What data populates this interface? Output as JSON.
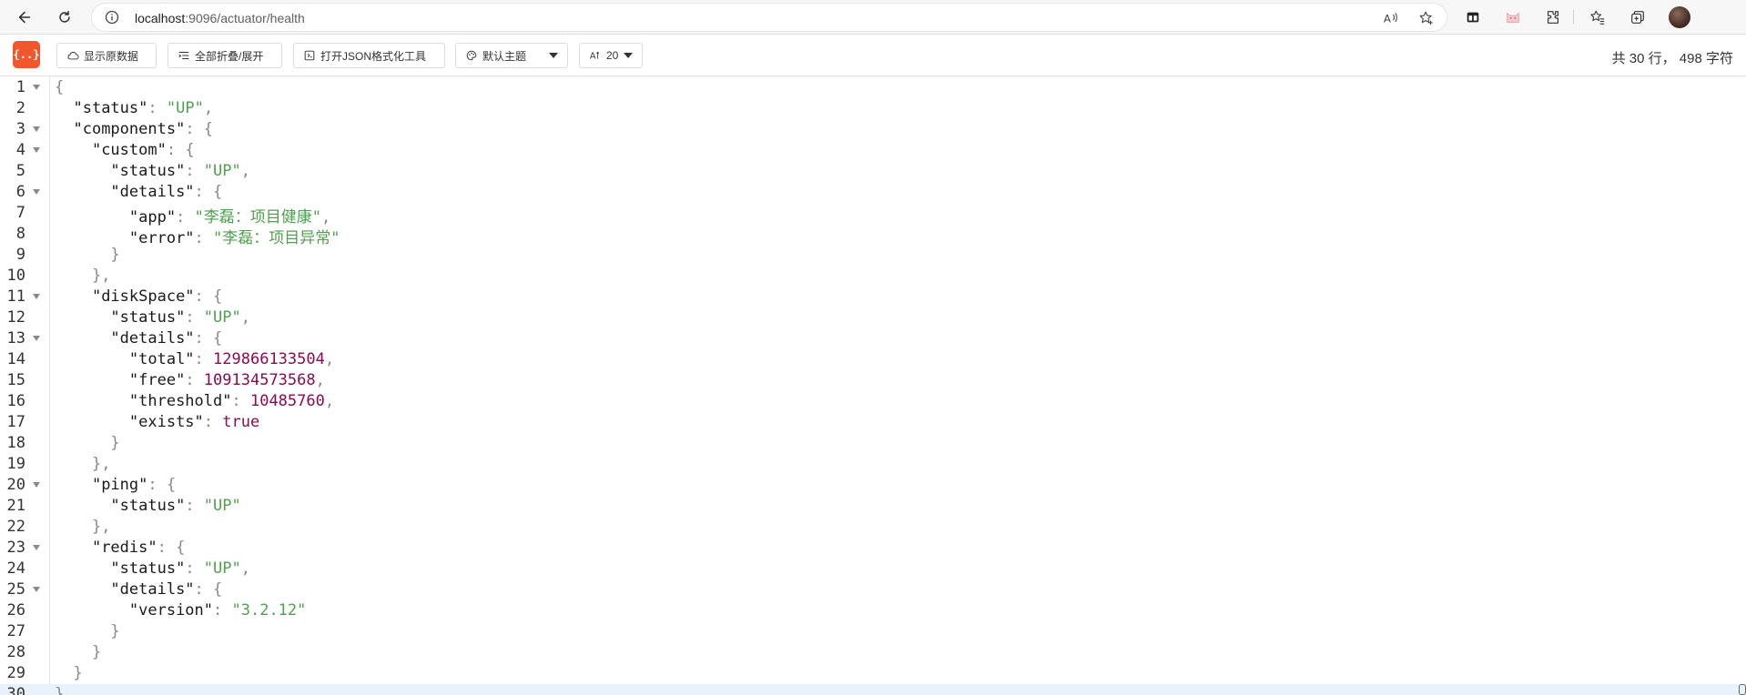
{
  "browser": {
    "url_host": "localhost",
    "url_path": ":9096/actuator/health",
    "icons": [
      "back-arrow-icon",
      "refresh-icon",
      "info-icon",
      "read-aloud-icon",
      "favorite-icon",
      "extension-sidebar-icon",
      "extension-cat-icon",
      "extensions-icon",
      "favorites-icon",
      "collections-icon",
      "profile-avatar"
    ]
  },
  "toolbar": {
    "logo_text": "{..}",
    "show_raw": "显示原数据",
    "fold_all": "全部折叠/展开",
    "open_tool": "打开JSON格式化工具",
    "theme": "默认主题",
    "font_size": "20",
    "stats": "共 30 行， 498 字符"
  },
  "colors": {
    "logo_bg": "#f0572d",
    "key": "#1a1a1a",
    "string": "#50a14f",
    "number": "#8b0a50",
    "punctuation": "#888888",
    "active_line": "#e8f2fc"
  },
  "editor": {
    "lines": [
      {
        "n": "1",
        "fold": true,
        "active": false,
        "tokens": [
          {
            "t": "p",
            "v": "{"
          }
        ]
      },
      {
        "n": "2",
        "fold": false,
        "active": false,
        "tokens": [
          {
            "t": "i",
            "v": "  "
          },
          {
            "t": "k",
            "v": "\"status\""
          },
          {
            "t": "p",
            "v": ": "
          },
          {
            "t": "s",
            "v": "\"UP\""
          },
          {
            "t": "p",
            "v": ","
          }
        ]
      },
      {
        "n": "3",
        "fold": true,
        "active": false,
        "tokens": [
          {
            "t": "i",
            "v": "  "
          },
          {
            "t": "k",
            "v": "\"components\""
          },
          {
            "t": "p",
            "v": ": {"
          }
        ]
      },
      {
        "n": "4",
        "fold": true,
        "active": false,
        "tokens": [
          {
            "t": "i",
            "v": "    "
          },
          {
            "t": "k",
            "v": "\"custom\""
          },
          {
            "t": "p",
            "v": ": {"
          }
        ]
      },
      {
        "n": "5",
        "fold": false,
        "active": false,
        "tokens": [
          {
            "t": "i",
            "v": "      "
          },
          {
            "t": "k",
            "v": "\"status\""
          },
          {
            "t": "p",
            "v": ": "
          },
          {
            "t": "s",
            "v": "\"UP\""
          },
          {
            "t": "p",
            "v": ","
          }
        ]
      },
      {
        "n": "6",
        "fold": true,
        "active": false,
        "tokens": [
          {
            "t": "i",
            "v": "      "
          },
          {
            "t": "k",
            "v": "\"details\""
          },
          {
            "t": "p",
            "v": ": {"
          }
        ]
      },
      {
        "n": "7",
        "fold": false,
        "active": false,
        "tokens": [
          {
            "t": "i",
            "v": "        "
          },
          {
            "t": "k",
            "v": "\"app\""
          },
          {
            "t": "p",
            "v": ": "
          },
          {
            "t": "s",
            "v": "\"李磊：项目健康\""
          },
          {
            "t": "p",
            "v": ","
          }
        ]
      },
      {
        "n": "8",
        "fold": false,
        "active": false,
        "tokens": [
          {
            "t": "i",
            "v": "        "
          },
          {
            "t": "k",
            "v": "\"error\""
          },
          {
            "t": "p",
            "v": ": "
          },
          {
            "t": "s",
            "v": "\"李磊：项目异常\""
          }
        ]
      },
      {
        "n": "9",
        "fold": false,
        "active": false,
        "tokens": [
          {
            "t": "i",
            "v": "      "
          },
          {
            "t": "p",
            "v": "}"
          }
        ]
      },
      {
        "n": "10",
        "fold": false,
        "active": false,
        "tokens": [
          {
            "t": "i",
            "v": "    "
          },
          {
            "t": "p",
            "v": "},"
          }
        ]
      },
      {
        "n": "11",
        "fold": true,
        "active": false,
        "tokens": [
          {
            "t": "i",
            "v": "    "
          },
          {
            "t": "k",
            "v": "\"diskSpace\""
          },
          {
            "t": "p",
            "v": ": {"
          }
        ]
      },
      {
        "n": "12",
        "fold": false,
        "active": false,
        "tokens": [
          {
            "t": "i",
            "v": "      "
          },
          {
            "t": "k",
            "v": "\"status\""
          },
          {
            "t": "p",
            "v": ": "
          },
          {
            "t": "s",
            "v": "\"UP\""
          },
          {
            "t": "p",
            "v": ","
          }
        ]
      },
      {
        "n": "13",
        "fold": true,
        "active": false,
        "tokens": [
          {
            "t": "i",
            "v": "      "
          },
          {
            "t": "k",
            "v": "\"details\""
          },
          {
            "t": "p",
            "v": ": {"
          }
        ]
      },
      {
        "n": "14",
        "fold": false,
        "active": false,
        "tokens": [
          {
            "t": "i",
            "v": "        "
          },
          {
            "t": "k",
            "v": "\"total\""
          },
          {
            "t": "p",
            "v": ": "
          },
          {
            "t": "n",
            "v": "129866133504"
          },
          {
            "t": "p",
            "v": ","
          }
        ]
      },
      {
        "n": "15",
        "fold": false,
        "active": false,
        "tokens": [
          {
            "t": "i",
            "v": "        "
          },
          {
            "t": "k",
            "v": "\"free\""
          },
          {
            "t": "p",
            "v": ": "
          },
          {
            "t": "n",
            "v": "109134573568"
          },
          {
            "t": "p",
            "v": ","
          }
        ]
      },
      {
        "n": "16",
        "fold": false,
        "active": false,
        "tokens": [
          {
            "t": "i",
            "v": "        "
          },
          {
            "t": "k",
            "v": "\"threshold\""
          },
          {
            "t": "p",
            "v": ": "
          },
          {
            "t": "n",
            "v": "10485760"
          },
          {
            "t": "p",
            "v": ","
          }
        ]
      },
      {
        "n": "17",
        "fold": false,
        "active": false,
        "tokens": [
          {
            "t": "i",
            "v": "        "
          },
          {
            "t": "k",
            "v": "\"exists\""
          },
          {
            "t": "p",
            "v": ": "
          },
          {
            "t": "b",
            "v": "true"
          }
        ]
      },
      {
        "n": "18",
        "fold": false,
        "active": false,
        "tokens": [
          {
            "t": "i",
            "v": "      "
          },
          {
            "t": "p",
            "v": "}"
          }
        ]
      },
      {
        "n": "19",
        "fold": false,
        "active": false,
        "tokens": [
          {
            "t": "i",
            "v": "    "
          },
          {
            "t": "p",
            "v": "},"
          }
        ]
      },
      {
        "n": "20",
        "fold": true,
        "active": false,
        "tokens": [
          {
            "t": "i",
            "v": "    "
          },
          {
            "t": "k",
            "v": "\"ping\""
          },
          {
            "t": "p",
            "v": ": {"
          }
        ]
      },
      {
        "n": "21",
        "fold": false,
        "active": false,
        "tokens": [
          {
            "t": "i",
            "v": "      "
          },
          {
            "t": "k",
            "v": "\"status\""
          },
          {
            "t": "p",
            "v": ": "
          },
          {
            "t": "s",
            "v": "\"UP\""
          }
        ]
      },
      {
        "n": "22",
        "fold": false,
        "active": false,
        "tokens": [
          {
            "t": "i",
            "v": "    "
          },
          {
            "t": "p",
            "v": "},"
          }
        ]
      },
      {
        "n": "23",
        "fold": true,
        "active": false,
        "tokens": [
          {
            "t": "i",
            "v": "    "
          },
          {
            "t": "k",
            "v": "\"redis\""
          },
          {
            "t": "p",
            "v": ": {"
          }
        ]
      },
      {
        "n": "24",
        "fold": false,
        "active": false,
        "tokens": [
          {
            "t": "i",
            "v": "      "
          },
          {
            "t": "k",
            "v": "\"status\""
          },
          {
            "t": "p",
            "v": ": "
          },
          {
            "t": "s",
            "v": "\"UP\""
          },
          {
            "t": "p",
            "v": ","
          }
        ]
      },
      {
        "n": "25",
        "fold": true,
        "active": false,
        "tokens": [
          {
            "t": "i",
            "v": "      "
          },
          {
            "t": "k",
            "v": "\"details\""
          },
          {
            "t": "p",
            "v": ": {"
          }
        ]
      },
      {
        "n": "26",
        "fold": false,
        "active": false,
        "tokens": [
          {
            "t": "i",
            "v": "        "
          },
          {
            "t": "k",
            "v": "\"version\""
          },
          {
            "t": "p",
            "v": ": "
          },
          {
            "t": "s",
            "v": "\"3.2.12\""
          }
        ]
      },
      {
        "n": "27",
        "fold": false,
        "active": false,
        "tokens": [
          {
            "t": "i",
            "v": "      "
          },
          {
            "t": "p",
            "v": "}"
          }
        ]
      },
      {
        "n": "28",
        "fold": false,
        "active": false,
        "tokens": [
          {
            "t": "i",
            "v": "    "
          },
          {
            "t": "p",
            "v": "}"
          }
        ]
      },
      {
        "n": "29",
        "fold": false,
        "active": false,
        "tokens": [
          {
            "t": "i",
            "v": "  "
          },
          {
            "t": "p",
            "v": "}"
          }
        ]
      },
      {
        "n": "30",
        "fold": false,
        "active": true,
        "tokens": [
          {
            "t": "p",
            "v": "}"
          }
        ]
      }
    ]
  }
}
